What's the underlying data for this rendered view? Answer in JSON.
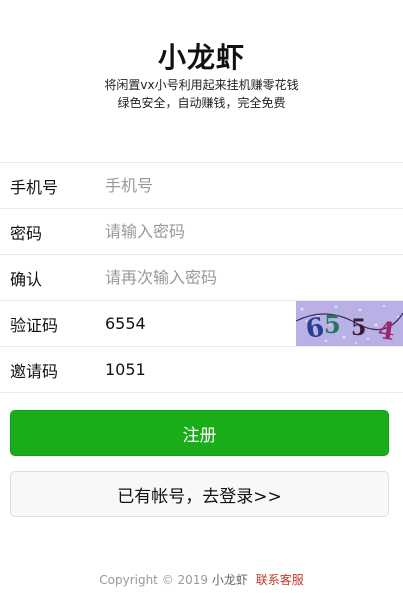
{
  "header": {
    "title": "小龙虾",
    "subtitle_line1": "将闲置vx小号利用起来挂机赚零花钱",
    "subtitle_line2": "绿色安全，自动赚钱，完全免费"
  },
  "form": {
    "phone": {
      "label": "手机号",
      "placeholder": "手机号",
      "value": ""
    },
    "password": {
      "label": "密码",
      "placeholder": "请输入密码",
      "value": ""
    },
    "confirm": {
      "label": "确认",
      "placeholder": "请再次输入密码",
      "value": ""
    },
    "captcha": {
      "label": "验证码",
      "value": "6554",
      "image_text": [
        "6",
        "5",
        "5",
        "4"
      ]
    },
    "invite": {
      "label": "邀请码",
      "value": "1051"
    }
  },
  "buttons": {
    "register_label": "注册",
    "login_label": "已有帐号，去登录>>"
  },
  "footer": {
    "copyright": "Copyright © 2019",
    "brand": "小龙虾",
    "contact": "联系客服"
  },
  "colors": {
    "primary": "#1aad19",
    "captcha_bg": "#b9b1e6",
    "link": "#c0392b"
  }
}
